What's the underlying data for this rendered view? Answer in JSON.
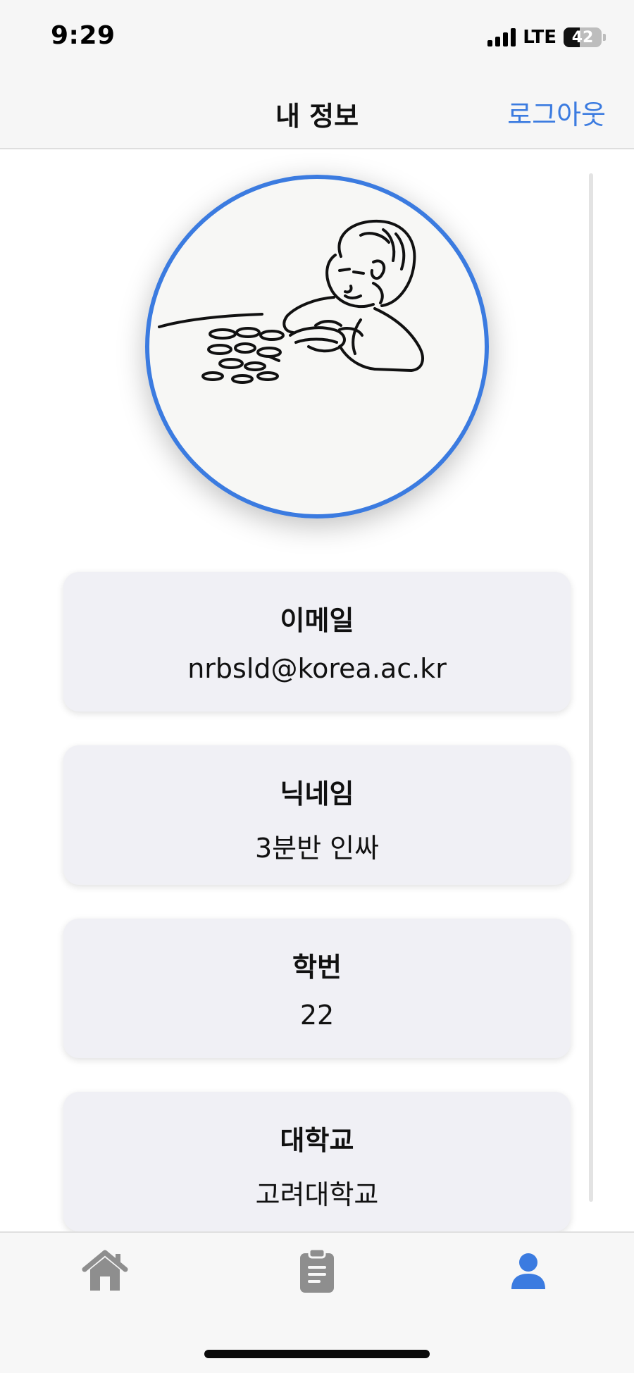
{
  "status_bar": {
    "time": "9:29",
    "network": "LTE",
    "battery": "42"
  },
  "nav": {
    "title": "내 정보",
    "logout_label": "로그아웃"
  },
  "profile": {
    "avatar_icon": "sketch-person-counting-coins-icon"
  },
  "cards": [
    {
      "label": "이메일",
      "value": "nrbsld@korea.ac.kr"
    },
    {
      "label": "닉네임",
      "value": "3분반 인싸"
    },
    {
      "label": "학번",
      "value": "22"
    },
    {
      "label": "대학교",
      "value": "고려대학교"
    }
  ],
  "tab_bar": {
    "items": [
      {
        "name": "home",
        "icon": "home-icon",
        "active": false
      },
      {
        "name": "board",
        "icon": "clipboard-icon",
        "active": false
      },
      {
        "name": "profile",
        "icon": "person-icon",
        "active": true
      }
    ]
  },
  "colors": {
    "accent": "#3b7be0",
    "inactive_icon": "#8e8e8e",
    "card_bg": "#f0f0f5"
  }
}
